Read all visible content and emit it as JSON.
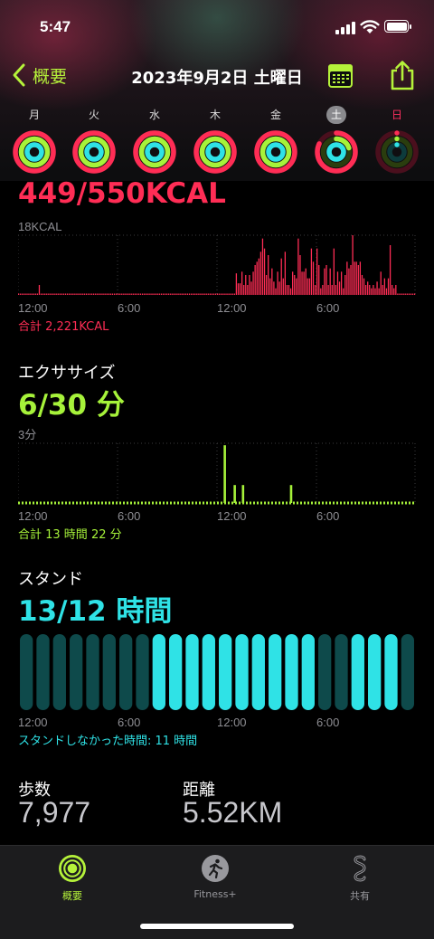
{
  "status_bar": {
    "time": "5:47"
  },
  "nav": {
    "back_label": "概要",
    "title": "2023年9月2日 土曜日"
  },
  "week": {
    "days": [
      {
        "label": "月",
        "move": 1.0,
        "exercise": 1.0,
        "stand": 1.0
      },
      {
        "label": "火",
        "move": 1.0,
        "exercise": 1.0,
        "stand": 1.0
      },
      {
        "label": "水",
        "move": 1.0,
        "exercise": 1.0,
        "stand": 1.0
      },
      {
        "label": "木",
        "move": 1.0,
        "exercise": 1.0,
        "stand": 1.0
      },
      {
        "label": "金",
        "move": 1.0,
        "exercise": 1.0,
        "stand": 1.0
      },
      {
        "label": "土",
        "move": 0.82,
        "exercise": 0.2,
        "stand": 1.0,
        "selected": true
      },
      {
        "label": "日",
        "move": 0.0,
        "exercise": 0.0,
        "stand": 0.0,
        "sunday": true
      }
    ]
  },
  "move": {
    "value": "449/550KCAL",
    "ymax_label": "18KCAL",
    "total": "合計 2,221KCAL",
    "color": "#ff2d55"
  },
  "exercise": {
    "title": "エクササイズ",
    "value": "6/30 分",
    "ymax_label": "3分",
    "total": "合計 13 時間 22 分",
    "color": "#a6f23a"
  },
  "stand": {
    "title": "スタンド",
    "value": "13/12 時間",
    "footer": "スタンドしなかった時間: 11 時間",
    "color": "#2fe2e6"
  },
  "x_ticks": [
    "12:00",
    "6:00",
    "12:00",
    "6:00"
  ],
  "steps": {
    "label": "歩数",
    "value": "7,977"
  },
  "distance": {
    "label": "距離",
    "value": "5.52KM"
  },
  "tabs": [
    {
      "label": "概要",
      "icon": "activity-rings-icon",
      "active": true
    },
    {
      "label": "Fitness+",
      "icon": "runner-icon",
      "active": false
    },
    {
      "label": "共有",
      "icon": "sharing-icon",
      "active": false
    }
  ],
  "chart_data": [
    {
      "type": "bar",
      "title": "449/550KCAL",
      "xlabel": "",
      "ylabel": "KCAL",
      "ylim": [
        0,
        18
      ],
      "x_tick_labels": [
        "12:00",
        "6:00",
        "12:00",
        "6:00"
      ],
      "x_range_hours": [
        0,
        24
      ],
      "series": [
        {
          "values": [
            0.3,
            0.3,
            0.3,
            0.3,
            0.3,
            0.3,
            0.3,
            0.3,
            0.3,
            0.3,
            0.3,
            3,
            0.3,
            0.3,
            0.3,
            0.3,
            0.3,
            0.3,
            0.3,
            0.3,
            0.3,
            0.3,
            0.3,
            0.3,
            0.3,
            0.3,
            0.3,
            0.3,
            0.3,
            0.3,
            0.3,
            0.3,
            0.3,
            0.3,
            0.3,
            0.3,
            0.3,
            0.3,
            0.3,
            0.3,
            0.3,
            0.3,
            0.3,
            0.3,
            0.3,
            0.3,
            0.3,
            0.3,
            0.3,
            0.3,
            0.3,
            0.3,
            0.3,
            0.3,
            0.3,
            0.3,
            0.3,
            0.3,
            0.3,
            0.3,
            0.3,
            0.3,
            0.3,
            0.3,
            0.3,
            0.3,
            0.3,
            0.3,
            0.3,
            0.3,
            0.3,
            0.3,
            0.3,
            0.3,
            0.3,
            0.3,
            0.3,
            0.3,
            0.3,
            0.3,
            0.3,
            0.3,
            0.3,
            0.3,
            0.3,
            0.3,
            0.3,
            0.3,
            0.3,
            0.3,
            0.3,
            0.3,
            0.3,
            0.3,
            0.3,
            0.3,
            0.3,
            0.3,
            0.3,
            0.3,
            0.3,
            0.3,
            0.3,
            0.3,
            0.3,
            0.3,
            0.3,
            0.3,
            0.3,
            0.3,
            0.3,
            0.3,
            0.3,
            0.3,
            0.3,
            0.3,
            6.5,
            3.5,
            3.5,
            7,
            3,
            6,
            3,
            6,
            4,
            7,
            9,
            10,
            11,
            13,
            17,
            14,
            6,
            12,
            5,
            8,
            4,
            2,
            7,
            4,
            11,
            5,
            13,
            3,
            3,
            2,
            7,
            6,
            5,
            17,
            12,
            7,
            7,
            8,
            5,
            5,
            14,
            10,
            3,
            14,
            9,
            2,
            3,
            8,
            9,
            3,
            8,
            3,
            14,
            3,
            7,
            4,
            7,
            2,
            6,
            10,
            8,
            9,
            18,
            10,
            10,
            9,
            10,
            6,
            5,
            3,
            4,
            3,
            2,
            3,
            2,
            4,
            2,
            7,
            3,
            5,
            2,
            5,
            15,
            3,
            2,
            3,
            0.3,
            0.3,
            0.3,
            0.3,
            0.3,
            0.3,
            0.3,
            0.3,
            0.3,
            0.3
          ]
        }
      ]
    },
    {
      "type": "bar",
      "title": "6/30 分",
      "xlabel": "",
      "ylabel": "分",
      "ylim": [
        0,
        3
      ],
      "x_tick_labels": [
        "12:00",
        "6:00",
        "12:00",
        "6:00"
      ],
      "x_range_hours": [
        0,
        24
      ],
      "series": [
        {
          "name": "exercise",
          "spikes": [
            {
              "hour": 12.4,
              "value": 2.9
            },
            {
              "hour": 13.0,
              "value": 0.9
            },
            {
              "hour": 13.5,
              "value": 0.9
            },
            {
              "hour": 16.4,
              "value": 0.9
            }
          ]
        }
      ]
    },
    {
      "type": "bar",
      "title": "13/12 時間",
      "xlabel": "",
      "ylabel": "",
      "x_tick_labels": [
        "12:00",
        "6:00",
        "12:00",
        "6:00"
      ],
      "categories_hours": [
        0,
        1,
        2,
        3,
        4,
        5,
        6,
        7,
        8,
        9,
        10,
        11,
        12,
        13,
        14,
        15,
        16,
        17,
        18,
        19,
        20,
        21,
        22,
        23
      ],
      "values": [
        0,
        0,
        0,
        0,
        0,
        0,
        0,
        0,
        1,
        1,
        1,
        1,
        1,
        1,
        1,
        1,
        1,
        1,
        0,
        0,
        1,
        1,
        1,
        0
      ]
    }
  ]
}
